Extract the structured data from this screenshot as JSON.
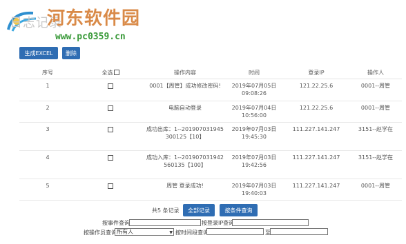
{
  "header": {
    "title": "日志记录",
    "watermark_main": "河东软件园",
    "watermark_url": "www.pc0359.cn"
  },
  "toolbar": {
    "export_label": "生成EXCEL",
    "delete_label": "删除"
  },
  "table": {
    "columns": [
      "序号",
      "全选",
      "操作内容",
      "时间",
      "登录IP",
      "操作人"
    ],
    "rows": [
      {
        "no": "1",
        "content": "0001【周管】成功修改密码!",
        "time": "2019年07月05日 09:08:26",
        "ip": "121.22.25.6",
        "operator": "0001--周管"
      },
      {
        "no": "2",
        "content": "电脑自动登录",
        "time": "2019年07月04日 10:56:00",
        "ip": "121.22.25.6",
        "operator": "0001--周管"
      },
      {
        "no": "3",
        "content": "成功出库：1--201907031945300125【10】",
        "time": "2019年07月03日 19:45:30",
        "ip": "111.227.141.247",
        "operator": "3151--赵学在"
      },
      {
        "no": "4",
        "content": "成功入库：1--201907031942560135【100】",
        "time": "2019年07月03日 19:42:56",
        "ip": "111.227.141.247",
        "operator": "3151--赵学在"
      },
      {
        "no": "5",
        "content": "周管 登录成功!",
        "time": "2019年07月03日 19:40:03",
        "ip": "111.227.141.247",
        "operator": "0001--周管"
      }
    ]
  },
  "pager": {
    "total_text": "共5 条记录",
    "all_label": "全部记录",
    "condition_label": "按条件查询"
  },
  "search": {
    "event_label": "按事件查询",
    "event_value": "",
    "ip_label": "按登录IP查询",
    "ip_value": "",
    "operator_label": "按操作员查询",
    "operator_selected": "所有人",
    "time_label": "按时间段查询",
    "time_from": "",
    "to_label": "至",
    "time_to": ""
  },
  "colors": {
    "button": "#2f6db3",
    "watermark_main": "#d98a48",
    "watermark_url": "#3a9a3a"
  }
}
